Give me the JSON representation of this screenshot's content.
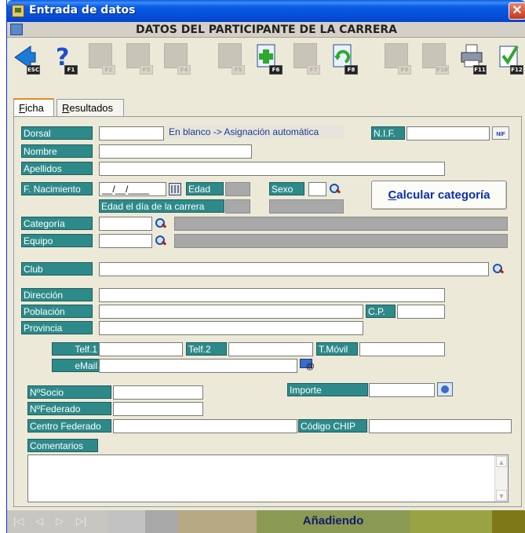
{
  "window": {
    "title": "Entrada de datos",
    "close": "✕"
  },
  "header": {
    "title": "DATOS DEL PARTICIPANTE DE LA CARRERA"
  },
  "toolbar": {
    "buttons": [
      {
        "key": "ESC",
        "icon": "exit-arrow-icon",
        "enabled": true
      },
      {
        "key": "F1",
        "icon": "help-icon",
        "enabled": true
      },
      {
        "key": "F2",
        "icon": "first-record-icon",
        "enabled": false
      },
      {
        "key": "F3",
        "icon": "home-icon",
        "enabled": false
      },
      {
        "key": "F4",
        "icon": "record-icon",
        "enabled": false
      },
      {
        "key": "F5",
        "icon": "record-icon",
        "enabled": false
      },
      {
        "key": "F6",
        "icon": "new-record-icon",
        "enabled": true
      },
      {
        "key": "F7",
        "icon": "record-icon",
        "enabled": false
      },
      {
        "key": "F8",
        "icon": "undo-icon",
        "enabled": true
      },
      {
        "key": "F9",
        "icon": "record-icon",
        "enabled": false
      },
      {
        "key": "F10",
        "icon": "record-icon",
        "enabled": false
      },
      {
        "key": "F11",
        "icon": "print-icon",
        "enabled": true
      },
      {
        "key": "F12",
        "icon": "accept-icon",
        "enabled": true
      }
    ]
  },
  "tabs": [
    {
      "label_ul": "F",
      "label_rest": "icha",
      "active": true
    },
    {
      "label_ul": "R",
      "label_rest": "esultados",
      "active": false
    }
  ],
  "form": {
    "dorsal_label": "Dorsal",
    "dorsal_value": "",
    "dorsal_hint": "En blanco -> Asignación automática",
    "nif_label": "N.I.F.",
    "nif_value": "",
    "nif_icon_text": "NIF",
    "nombre_label": "Nombre",
    "apellidos_label": "Apellidos",
    "fnac_label": "F. Nacimiento",
    "fnac_value": "__/__/____",
    "edad_label": "Edad",
    "edad_carrera_label": "Edad el día de la carrera",
    "sexo_label": "Sexo",
    "calc_ul": "C",
    "calc_rest": "alcular categoría",
    "categoria_label": "Categoría",
    "equipo_label": "Equipo",
    "club_label": "Club",
    "direccion_label": "Dirección",
    "poblacion_label": "Población",
    "cp_label": "C.P.",
    "provincia_label": "Provincia",
    "telf1_label": "Telf.1",
    "telf2_label": "Telf.2",
    "tmovil_label": "T.Móvil",
    "email_label": "eMail",
    "nsocio_label": "NºSocio",
    "importe_label": "Importe",
    "nfederado_label": "NºFederado",
    "centro_label": "Centro Federado",
    "chip_label": "Código CHIP",
    "comentarios_label": "Comentarios"
  },
  "status": {
    "nav": [
      "|◁",
      "◁",
      "▷",
      "▷|"
    ],
    "mode": "Añadiendo"
  },
  "colors": {
    "label_bg": "#2e8a8a",
    "title_bar": "#0a5ce8",
    "link_blue": "#0c2fa6"
  }
}
